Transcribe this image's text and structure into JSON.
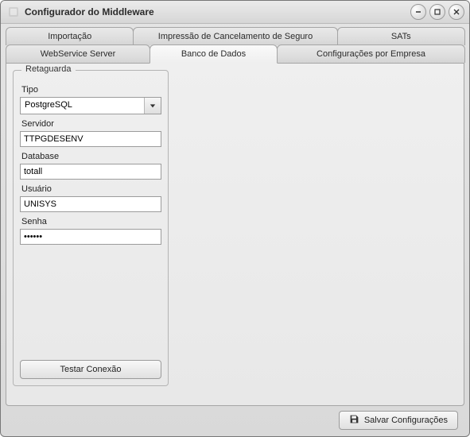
{
  "window": {
    "title": "Configurador do Middleware"
  },
  "tabs_row1": [
    {
      "label": "Importação"
    },
    {
      "label": "Impressão de Cancelamento de Seguro"
    },
    {
      "label": "SATs"
    }
  ],
  "tabs_row2": [
    {
      "label": "WebService Server"
    },
    {
      "label": "Banco de Dados",
      "active": true
    },
    {
      "label": "Configurações por Empresa"
    }
  ],
  "group": {
    "title": "Retaguarda",
    "tipo": {
      "label": "Tipo",
      "value": "PostgreSQL"
    },
    "servidor": {
      "label": "Servidor",
      "value": "TTPGDESENV"
    },
    "database": {
      "label": "Database",
      "value": "totall"
    },
    "usuario": {
      "label": "Usuário",
      "value": "UNISYS"
    },
    "senha": {
      "label": "Senha",
      "value": "••••••"
    },
    "test_button": "Testar Conexão"
  },
  "footer": {
    "save": "Salvar Configurações"
  }
}
